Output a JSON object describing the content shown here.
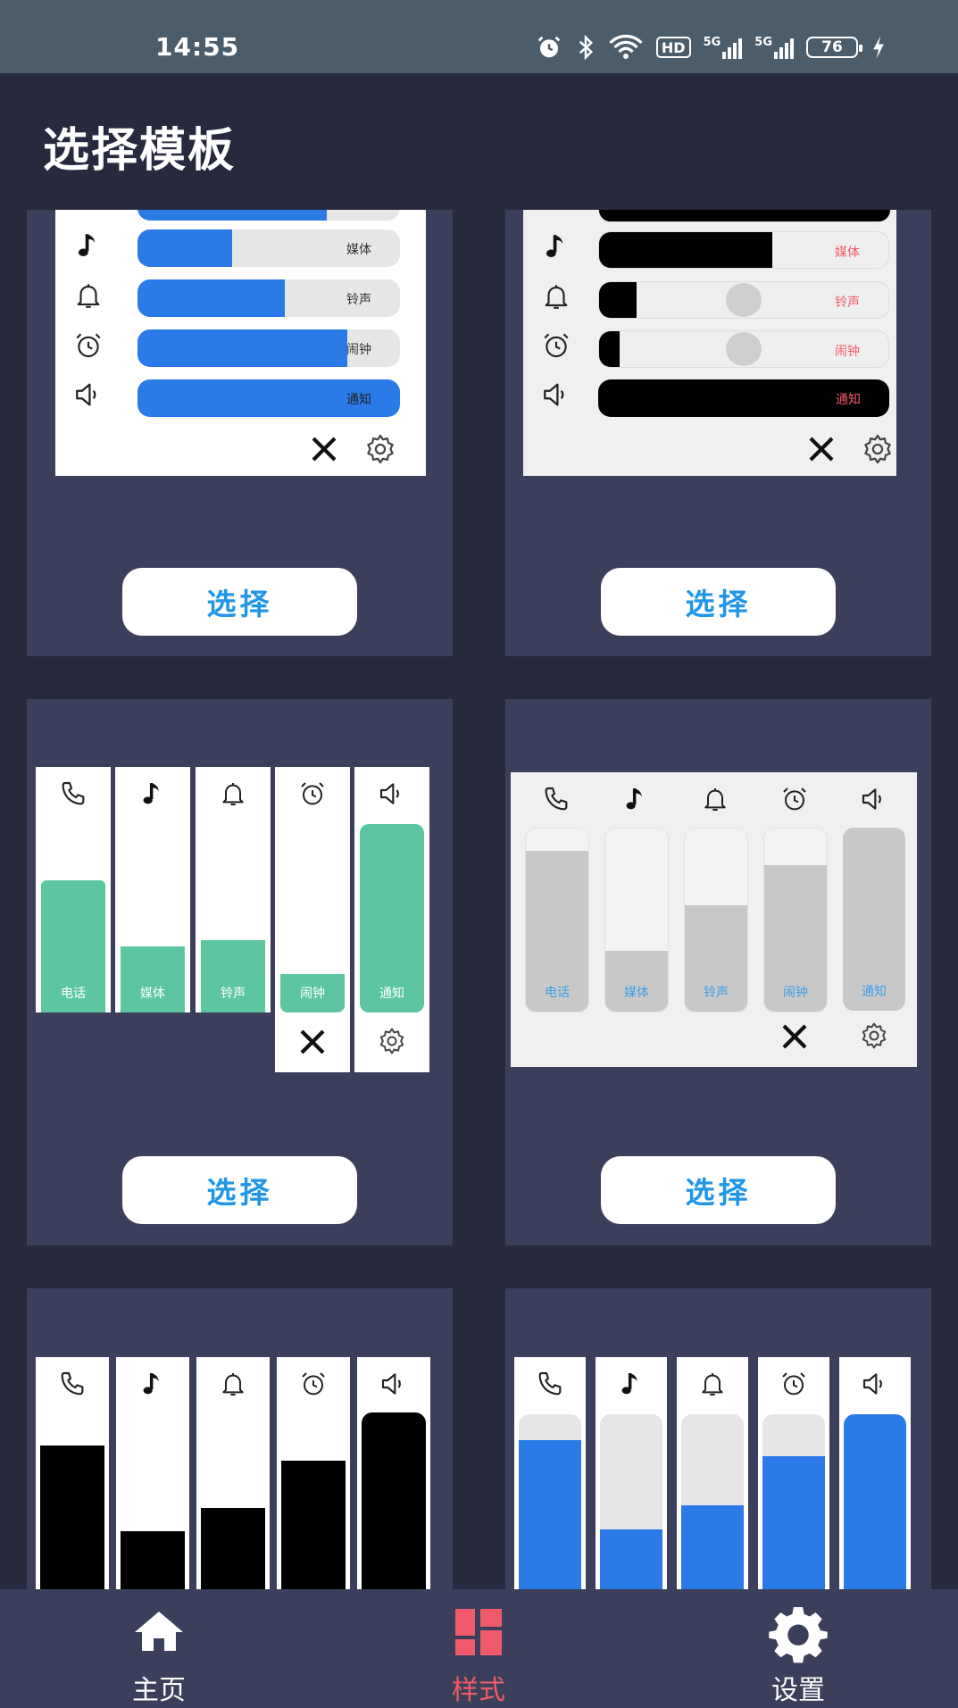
{
  "status_bar": {
    "time": "14:55",
    "network_hd": "HD",
    "signal1_label": "5G",
    "signal2_label": "5G",
    "battery_level": "76",
    "icons": [
      "alarm-icon",
      "bluetooth-icon",
      "wifi-icon",
      "hd-icon",
      "signal-5g-icon",
      "signal-5g-icon",
      "battery-icon",
      "charging-icon"
    ]
  },
  "header": {
    "title": "选择模板"
  },
  "select_label": "选择",
  "volume_labels": {
    "call": "电话",
    "media": "媒体",
    "ringtone": "铃声",
    "alarm": "闹钟",
    "notification": "通知"
  },
  "templates": [
    {
      "style": "horizontal-blue",
      "accent": "#2a7ae8",
      "levels": {
        "media": 0.36,
        "ringtone": 0.56,
        "alarm": 0.8,
        "notification": 1.0
      }
    },
    {
      "style": "horizontal-black",
      "accent": "#000000",
      "label_color": "#f05b6b",
      "levels": {
        "media": 0.6,
        "ringtone": 0.13,
        "alarm": 0.07,
        "notification": 1.0
      }
    },
    {
      "style": "vertical-green",
      "accent": "#5cc6a1",
      "levels": {
        "call": 0.8,
        "media": 0.4,
        "ringtone": 0.44,
        "alarm": 0.23,
        "notification": 1.0
      }
    },
    {
      "style": "vertical-grey",
      "accent": "#c8c8c8",
      "label_color": "#3aa0e8",
      "levels": {
        "call": 0.88,
        "media": 0.33,
        "ringtone": 0.58,
        "alarm": 0.8,
        "notification": 1.0
      }
    },
    {
      "style": "vertical-black",
      "accent": "#000000",
      "levels": {
        "call": 0.85,
        "media": 0.34,
        "ringtone": 0.48,
        "alarm": 0.76,
        "notification": 1.0
      }
    },
    {
      "style": "vertical-blue",
      "accent": "#2a7ae8",
      "levels": {
        "call": 0.85,
        "media": 0.34,
        "ringtone": 0.48,
        "alarm": 0.76,
        "notification": 1.0
      }
    }
  ],
  "bottom_nav": [
    {
      "label": "主页",
      "icon": "home-icon",
      "active": false
    },
    {
      "label": "样式",
      "icon": "style-grid-icon",
      "active": true,
      "active_color": "#f05b6b"
    },
    {
      "label": "设置",
      "icon": "gear-icon",
      "active": false
    }
  ]
}
